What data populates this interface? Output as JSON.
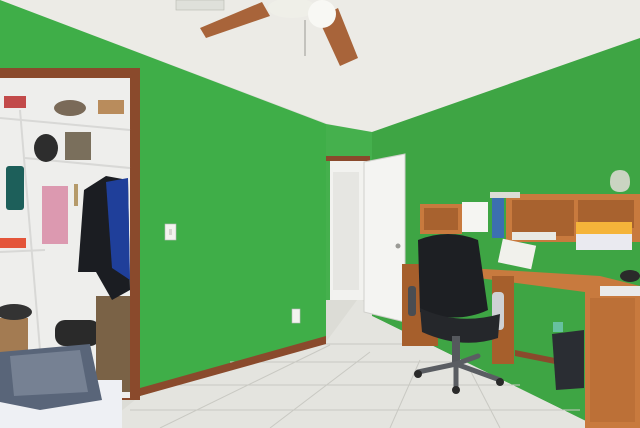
{
  "scene": {
    "kind": "photo-interior-bedroom-office",
    "palette": {
      "wall_left": "#3fae48",
      "wall_left_shadow": "#2f9a3c",
      "wall_right": "#3ea544",
      "wall_back": "#45b04d",
      "ceiling": "#ecebe6",
      "floor": "#e4e4df",
      "floor_grout": "#c9c9c3",
      "baseboard": "#8a4a2c",
      "door": "#f4f4f2",
      "door_frame": "#8a4a2c",
      "closet_frame": "#8a4a2c",
      "closet_inside": "#eeeeec",
      "desk_wood": "#c87a3e",
      "desk_wood_dark": "#a65f2c",
      "chair": "#1d1f23",
      "fan_blade": "#a8643a",
      "bedding": "#eef0f4"
    },
    "elements": [
      "ceiling-fan",
      "open-closet-with-shelves",
      "light-switch",
      "interior-door",
      "hallway",
      "wall-hutch-desk",
      "office-chair",
      "waste-basket",
      "bed-corner",
      "tile-floor"
    ]
  }
}
